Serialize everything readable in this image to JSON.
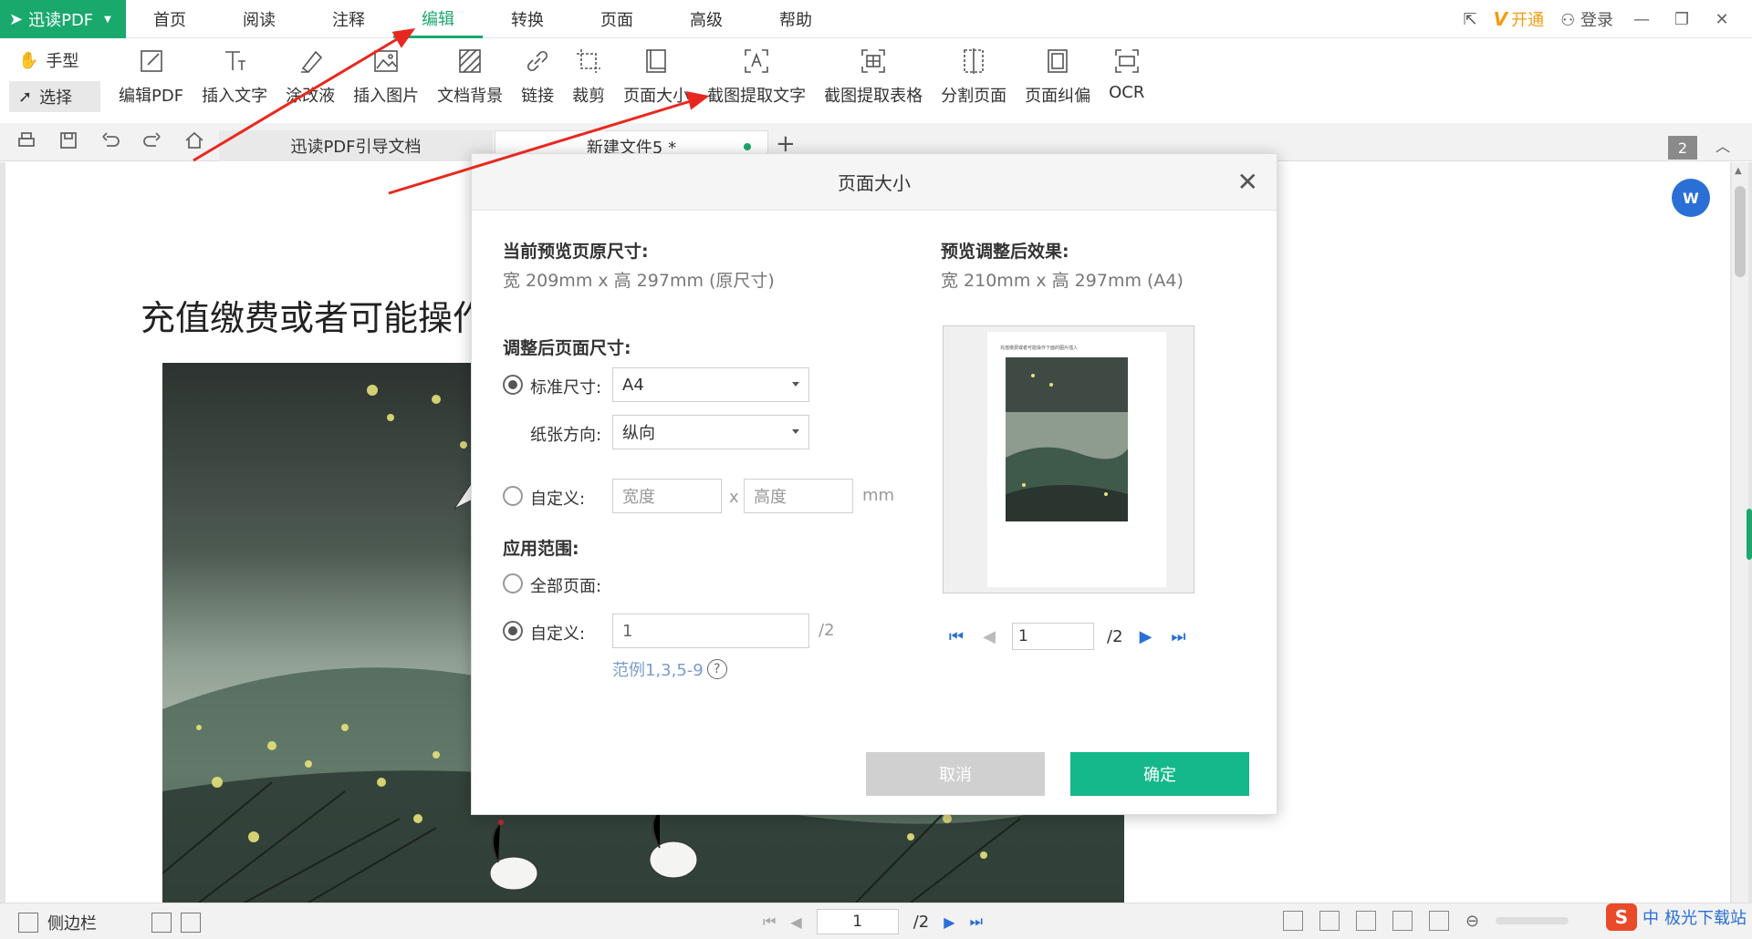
{
  "app": {
    "brand": "迅读PDF",
    "menu": [
      "首页",
      "阅读",
      "注释",
      "编辑",
      "转换",
      "页面",
      "高级",
      "帮助"
    ],
    "active_menu": "编辑",
    "vip_label": "开通",
    "login_label": "登录"
  },
  "toolbar": {
    "modes": [
      "手型",
      "选择"
    ],
    "tools": [
      {
        "label": "编辑PDF",
        "icon": "edit-pdf-icon"
      },
      {
        "label": "插入文字",
        "icon": "insert-text-icon"
      },
      {
        "label": "涂改液",
        "icon": "correction-fluid-icon"
      },
      {
        "label": "插入图片",
        "icon": "insert-image-icon"
      },
      {
        "label": "文档背景",
        "icon": "document-background-icon"
      },
      {
        "label": "链接",
        "icon": "link-icon"
      },
      {
        "label": "裁剪",
        "icon": "crop-icon"
      },
      {
        "label": "页面大小",
        "icon": "page-size-icon"
      },
      {
        "label": "截图提取文字",
        "icon": "screenshot-text-icon"
      },
      {
        "label": "截图提取表格",
        "icon": "screenshot-table-icon"
      },
      {
        "label": "分割页面",
        "icon": "split-page-icon"
      },
      {
        "label": "页面纠偏",
        "icon": "page-deskew-icon"
      },
      {
        "label": "OCR",
        "icon": "ocr-icon"
      }
    ]
  },
  "tabs": {
    "items": [
      "迅读PDF引导文档",
      "新建文件5 *"
    ],
    "add": "+",
    "page_badge": "2"
  },
  "document": {
    "heading": "充值缴费或者可能操作"
  },
  "dialog": {
    "title": "页面大小",
    "close": "✕",
    "original_label": "当前预览页原尺寸:",
    "original_value": "宽 209mm x 高 297mm (原尺寸)",
    "preview_label": "预览调整后效果:",
    "preview_value": "宽 210mm x 高 297mm (A4)",
    "adjusted_label": "调整后页面尺寸:",
    "standard_label": "标准尺寸:",
    "standard_value": "A4",
    "orientation_label": "纸张方向:",
    "orientation_value": "纵向",
    "custom_label": "自定义:",
    "width_placeholder": "宽度",
    "x_sep": "x",
    "height_placeholder": "高度",
    "unit": "mm",
    "range_label": "应用范围:",
    "all_pages_label": "全部页面:",
    "custom_range_label": "自定义:",
    "custom_range_value": "1",
    "custom_range_total": "/2",
    "range_hint": "范例1,3,5-9",
    "preview_text": "充值缴费或者可能操作下面的图片插入",
    "pager_value": "1",
    "pager_total": "/2",
    "cancel": "取消",
    "ok": "确定",
    "standard_selected": true,
    "custom_range_selected": true
  },
  "status": {
    "sidebar_label": "侧边栏",
    "page_value": "1",
    "page_total": "/2",
    "ime_label": "中",
    "watermark": "极光下载站"
  },
  "colors": {
    "accent": "#1aa96d",
    "ok_button": "#14b88a",
    "arrow": "#e8281e"
  }
}
